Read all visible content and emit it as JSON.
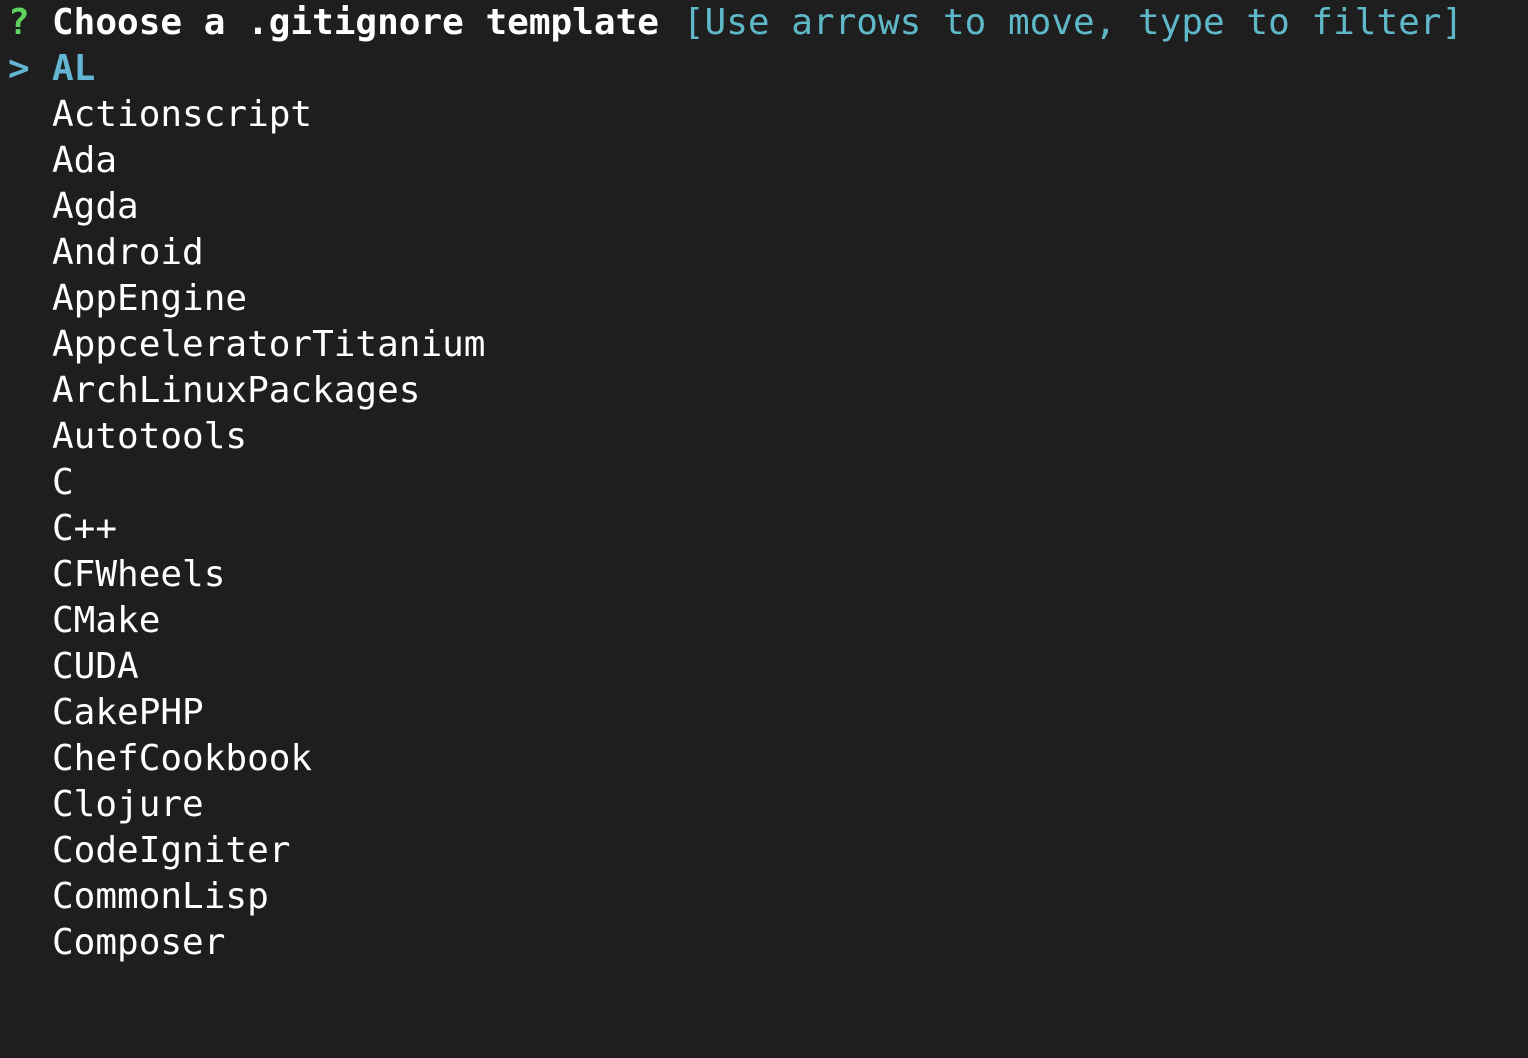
{
  "prompt": {
    "marker": "?",
    "title": "Choose a .gitignore template",
    "hint": "[Use arrows to move, type to filter]"
  },
  "cursor": {
    "symbol": ">"
  },
  "options": [
    "AL",
    "Actionscript",
    "Ada",
    "Agda",
    "Android",
    "AppEngine",
    "AppceleratorTitanium",
    "ArchLinuxPackages",
    "Autotools",
    "C",
    "C++",
    "CFWheels",
    "CMake",
    "CUDA",
    "CakePHP",
    "ChefCookbook",
    "Clojure",
    "CodeIgniter",
    "CommonLisp",
    "Composer"
  ],
  "selected_index": 0,
  "colors": {
    "background": "#1e1e1e",
    "question_mark": "#5fd35f",
    "selected": "#64b4d4",
    "hint": "#5fb8c8",
    "text": "#ffffff"
  }
}
